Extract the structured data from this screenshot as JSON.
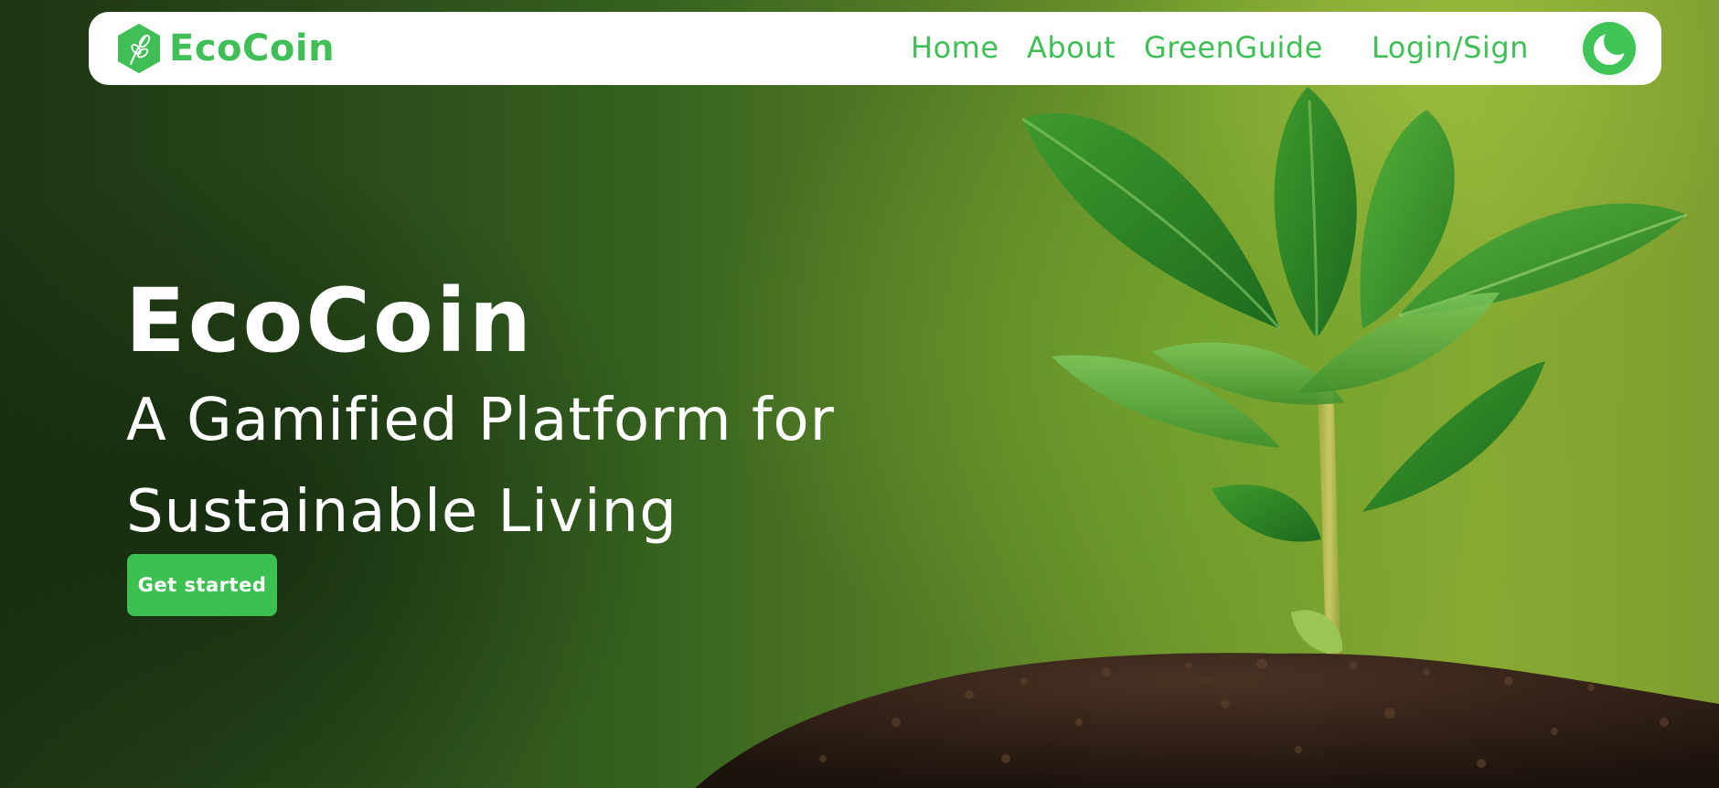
{
  "brand": {
    "name": "EcoCoin",
    "logo_icon": "leaf-hexagon-icon",
    "color": "#3fbf55"
  },
  "nav": {
    "links": [
      "Home",
      "About",
      "GreenGuide",
      "Login/Sign"
    ],
    "theme_toggle_icon": "moon-icon"
  },
  "hero": {
    "title": "EcoCoin",
    "subtitle": "A Gamified Platform for Sustainable Living",
    "cta_label": "Get started",
    "background_image": "seedling-in-soil-photo"
  },
  "colors": {
    "accent": "#3cc052",
    "text_on_hero": "#ffffff",
    "nav_background": "#ffffff"
  }
}
